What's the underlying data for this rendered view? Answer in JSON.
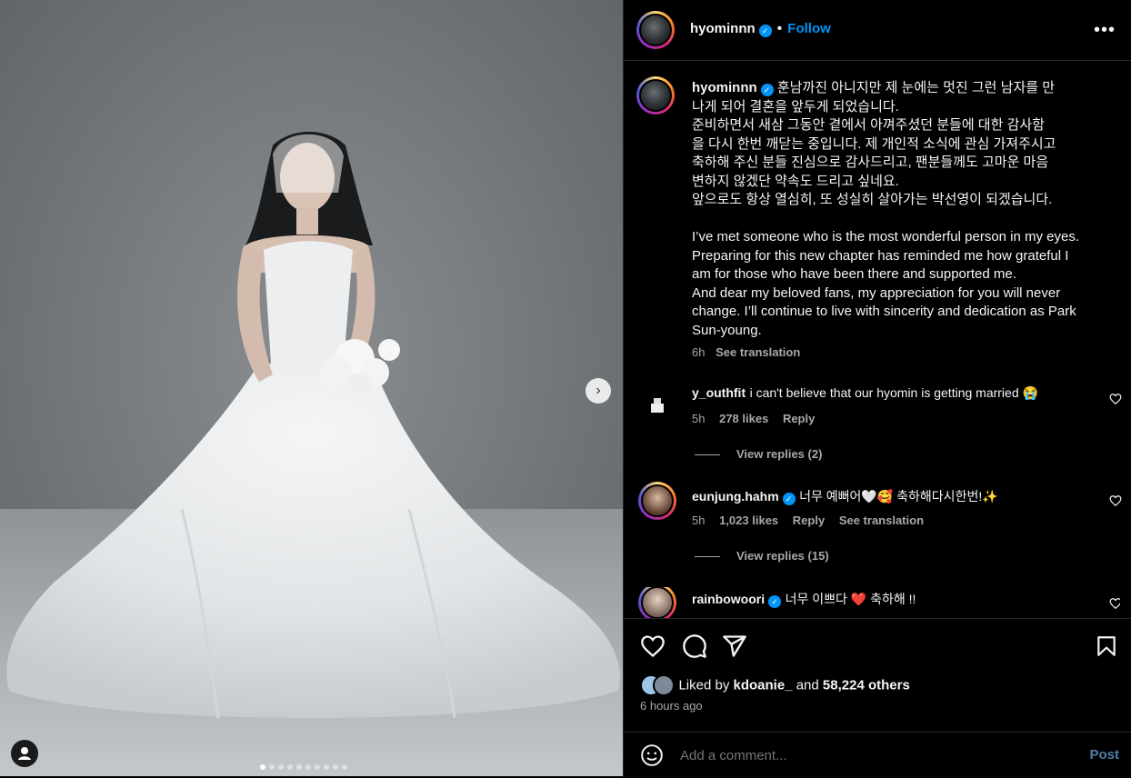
{
  "post": {
    "username": "hyominnn",
    "follow_label": "Follow",
    "caption_lines": [
      "훈남까진 아니지만 제 눈에는 멋진 그런 남자를 만",
      "나게 되어 결혼을 앞두게 되었습니다.",
      "준비하면서 새삼 그동안 곁에서 아껴주셨던 분들에 대한 감사함",
      "을 다시 한번 깨닫는 중입니다. 제 개인적 소식에 관심 가져주시고",
      "축하해 주신 분들 진심으로 감사드리고, 팬분들께도 고마운 마음",
      "변하지 않겠단 약속도 드리고 싶네요.",
      "앞으로도 항상 열심히, 또 성실히 살아가는 박선영이 되겠습니다.",
      "",
      "I’ve met someone who is the most wonderful person in my eyes.",
      "Preparing for this new chapter has reminded me how grateful I",
      "am for those who have been there and supported me.",
      "And dear my beloved fans, my appreciation for you will never",
      "change. I’ll continue to live with sincerity and dedication as Park",
      "Sun-young."
    ],
    "caption_time": "6h",
    "see_translation": "See translation"
  },
  "comments": [
    {
      "username": "y_outhfit",
      "text": "i can't believe that our hyomin is getting married 😭",
      "time": "5h",
      "likes": "278 likes",
      "reply": "Reply",
      "view_replies": "View replies (2)"
    },
    {
      "username": "eunjung.hahm",
      "text": "너무 예뻐어🤍🥰 축하해다시한번!✨",
      "time": "5h",
      "likes": "1,023 likes",
      "reply": "Reply",
      "translation": "See translation",
      "view_replies": "View replies (15)"
    },
    {
      "username": "rainbowoori",
      "text": "너무 이쁘다 ❤️ 축하해 !!"
    }
  ],
  "footer": {
    "liked_by_prefix": "Liked by ",
    "liked_by_user": "kdoanie_",
    "and": " and ",
    "others": "58,224 others",
    "time_ago": "6 hours ago",
    "comment_placeholder": "Add a comment...",
    "post_label": "Post"
  },
  "carousel": {
    "total": 10,
    "active": 1
  },
  "colors": {
    "accent": "#0095f6",
    "background": "#000000",
    "secondary_text": "#a8a8a8",
    "like_red": "#ff3040"
  }
}
